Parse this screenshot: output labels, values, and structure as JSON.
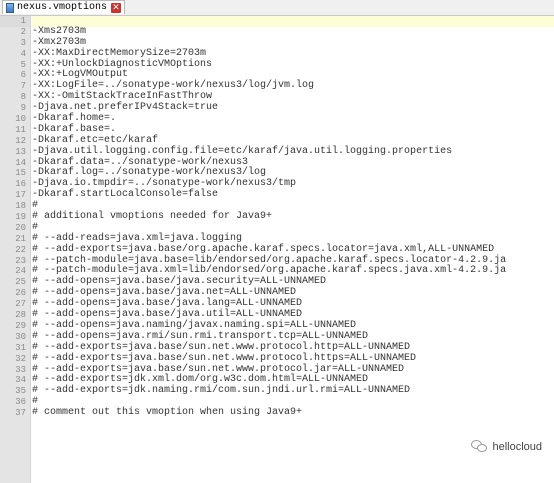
{
  "tab": {
    "filename": "nexus.vmoptions",
    "close_symbol": "✕"
  },
  "editor": {
    "current_line": 1,
    "lines": [
      {
        "num": "1",
        "text": ""
      },
      {
        "num": "2",
        "text": "-Xms2703m"
      },
      {
        "num": "3",
        "text": "-Xmx2703m"
      },
      {
        "num": "4",
        "text": "-XX:MaxDirectMemorySize=2703m"
      },
      {
        "num": "5",
        "text": "-XX:+UnlockDiagnosticVMOptions"
      },
      {
        "num": "6",
        "text": "-XX:+LogVMOutput"
      },
      {
        "num": "7",
        "text": "-XX:LogFile=../sonatype-work/nexus3/log/jvm.log"
      },
      {
        "num": "8",
        "text": "-XX:-OmitStackTraceInFastThrow"
      },
      {
        "num": "9",
        "text": "-Djava.net.preferIPv4Stack=true"
      },
      {
        "num": "10",
        "text": "-Dkaraf.home=."
      },
      {
        "num": "11",
        "text": "-Dkaraf.base=."
      },
      {
        "num": "12",
        "text": "-Dkaraf.etc=etc/karaf"
      },
      {
        "num": "13",
        "text": "-Djava.util.logging.config.file=etc/karaf/java.util.logging.properties"
      },
      {
        "num": "14",
        "text": "-Dkaraf.data=../sonatype-work/nexus3"
      },
      {
        "num": "15",
        "text": "-Dkaraf.log=../sonatype-work/nexus3/log"
      },
      {
        "num": "16",
        "text": "-Djava.io.tmpdir=../sonatype-work/nexus3/tmp"
      },
      {
        "num": "17",
        "text": "-Dkaraf.startLocalConsole=false"
      },
      {
        "num": "18",
        "text": "#"
      },
      {
        "num": "19",
        "text": "# additional vmoptions needed for Java9+"
      },
      {
        "num": "20",
        "text": "#"
      },
      {
        "num": "21",
        "text": "# --add-reads=java.xml=java.logging"
      },
      {
        "num": "22",
        "text": "# --add-exports=java.base/org.apache.karaf.specs.locator=java.xml,ALL-UNNAMED"
      },
      {
        "num": "23",
        "text": "# --patch-module=java.base=lib/endorsed/org.apache.karaf.specs.locator-4.2.9.ja"
      },
      {
        "num": "24",
        "text": "# --patch-module=java.xml=lib/endorsed/org.apache.karaf.specs.java.xml-4.2.9.ja"
      },
      {
        "num": "25",
        "text": "# --add-opens=java.base/java.security=ALL-UNNAMED"
      },
      {
        "num": "26",
        "text": "# --add-opens=java.base/java.net=ALL-UNNAMED"
      },
      {
        "num": "27",
        "text": "# --add-opens=java.base/java.lang=ALL-UNNAMED"
      },
      {
        "num": "28",
        "text": "# --add-opens=java.base/java.util=ALL-UNNAMED"
      },
      {
        "num": "29",
        "text": "# --add-opens=java.naming/javax.naming.spi=ALL-UNNAMED"
      },
      {
        "num": "30",
        "text": "# --add-opens=java.rmi/sun.rmi.transport.tcp=ALL-UNNAMED"
      },
      {
        "num": "31",
        "text": "# --add-exports=java.base/sun.net.www.protocol.http=ALL-UNNAMED"
      },
      {
        "num": "32",
        "text": "# --add-exports=java.base/sun.net.www.protocol.https=ALL-UNNAMED"
      },
      {
        "num": "33",
        "text": "# --add-exports=java.base/sun.net.www.protocol.jar=ALL-UNNAMED"
      },
      {
        "num": "34",
        "text": "# --add-exports=jdk.xml.dom/org.w3c.dom.html=ALL-UNNAMED"
      },
      {
        "num": "35",
        "text": "# --add-exports=jdk.naming.rmi/com.sun.jndi.url.rmi=ALL-UNNAMED"
      },
      {
        "num": "36",
        "text": "#"
      },
      {
        "num": "37",
        "text": "# comment out this vmoption when using Java9+"
      }
    ]
  },
  "watermark": {
    "text": "hellocloud",
    "icon": "wechat-icon"
  }
}
